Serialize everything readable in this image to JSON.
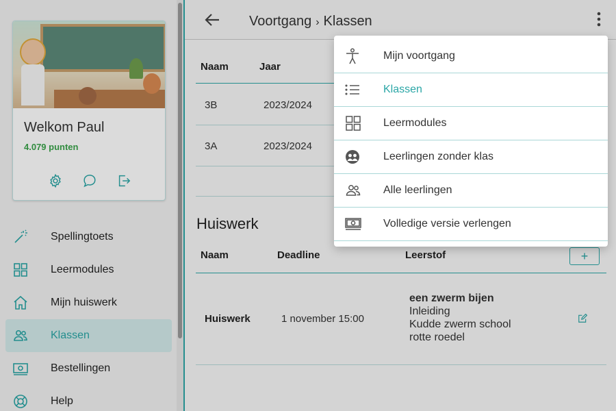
{
  "profile": {
    "greeting": "Welkom Paul",
    "points": "4.079 punten",
    "actions": [
      "gear-icon",
      "chat-icon",
      "logout-icon"
    ]
  },
  "sidebar": {
    "items": [
      {
        "label": "Spellingtoets",
        "icon": "magic-wand-icon"
      },
      {
        "label": "Leermodules",
        "icon": "grid-icon"
      },
      {
        "label": "Mijn huiswerk",
        "icon": "home-icon"
      },
      {
        "label": "Klassen",
        "icon": "users-icon",
        "active": true
      },
      {
        "label": "Bestellingen",
        "icon": "banknote-icon"
      },
      {
        "label": "Help",
        "icon": "lifebuoy-icon"
      }
    ]
  },
  "header": {
    "crumb_parent": "Voortgang",
    "separator": "›",
    "crumb_current": "Klassen"
  },
  "classes_table": {
    "columns": [
      "Naam",
      "Jaar"
    ],
    "rows": [
      {
        "naam": "3B",
        "jaar": "2023/2024"
      },
      {
        "naam": "3A",
        "jaar": "2023/2024"
      }
    ]
  },
  "homework": {
    "title": "Huiswerk",
    "columns": [
      "Naam",
      "Deadline",
      "Leerstof"
    ],
    "add_label": "+",
    "rows": [
      {
        "naam": "Huiswerk",
        "deadline": "1 november 15:00",
        "leerstof_title": "een zwerm bijen",
        "leerstof_lines": [
          "Inleiding",
          "Kudde zwerm school",
          "rotte roedel"
        ]
      }
    ]
  },
  "menu": {
    "items": [
      {
        "label": "Mijn voortgang",
        "icon": "person-icon"
      },
      {
        "label": "Klassen",
        "icon": "list-icon",
        "active": true
      },
      {
        "label": "Leermodules",
        "icon": "grid-icon"
      },
      {
        "label": "Leerlingen zonder klas",
        "icon": "group-circle-icon"
      },
      {
        "label": "Alle leerlingen",
        "icon": "users-icon"
      },
      {
        "label": "Volledige versie verlengen",
        "icon": "banknote-icon"
      }
    ]
  },
  "colors": {
    "accent": "#2aa6a6",
    "points": "#3aa34a"
  }
}
